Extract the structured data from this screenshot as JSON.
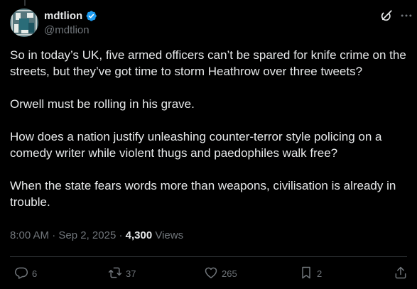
{
  "author": {
    "display_name": "mdtlion",
    "handle": "@mdtlion",
    "verified": true,
    "avatar_icon": "portrait-avatar",
    "verified_color": "#1d9bf0"
  },
  "tweet": {
    "paragraphs": [
      "So in today’s UK, five armed officers can’t be spared for knife crime on the streets, but they’ve got time to storm Heathrow over three tweets?",
      "Orwell must be rolling in his grave.",
      "How does a nation justify unleashing counter-terror style policing on a comedy writer while violent thugs and paedophiles walk free?",
      "When the state fears words more than weapons, civilisation is already in trouble."
    ],
    "time": "8:00 AM",
    "date": "Sep 2, 2025",
    "views": "4,300",
    "views_label": "Views",
    "separator": "·"
  },
  "actions": {
    "replies": "6",
    "reposts": "37",
    "likes": "265",
    "bookmarks": "2"
  },
  "colors": {
    "background": "#000000",
    "text": "#e7e9ea",
    "muted": "#71767b",
    "divider": "#2f3336"
  }
}
